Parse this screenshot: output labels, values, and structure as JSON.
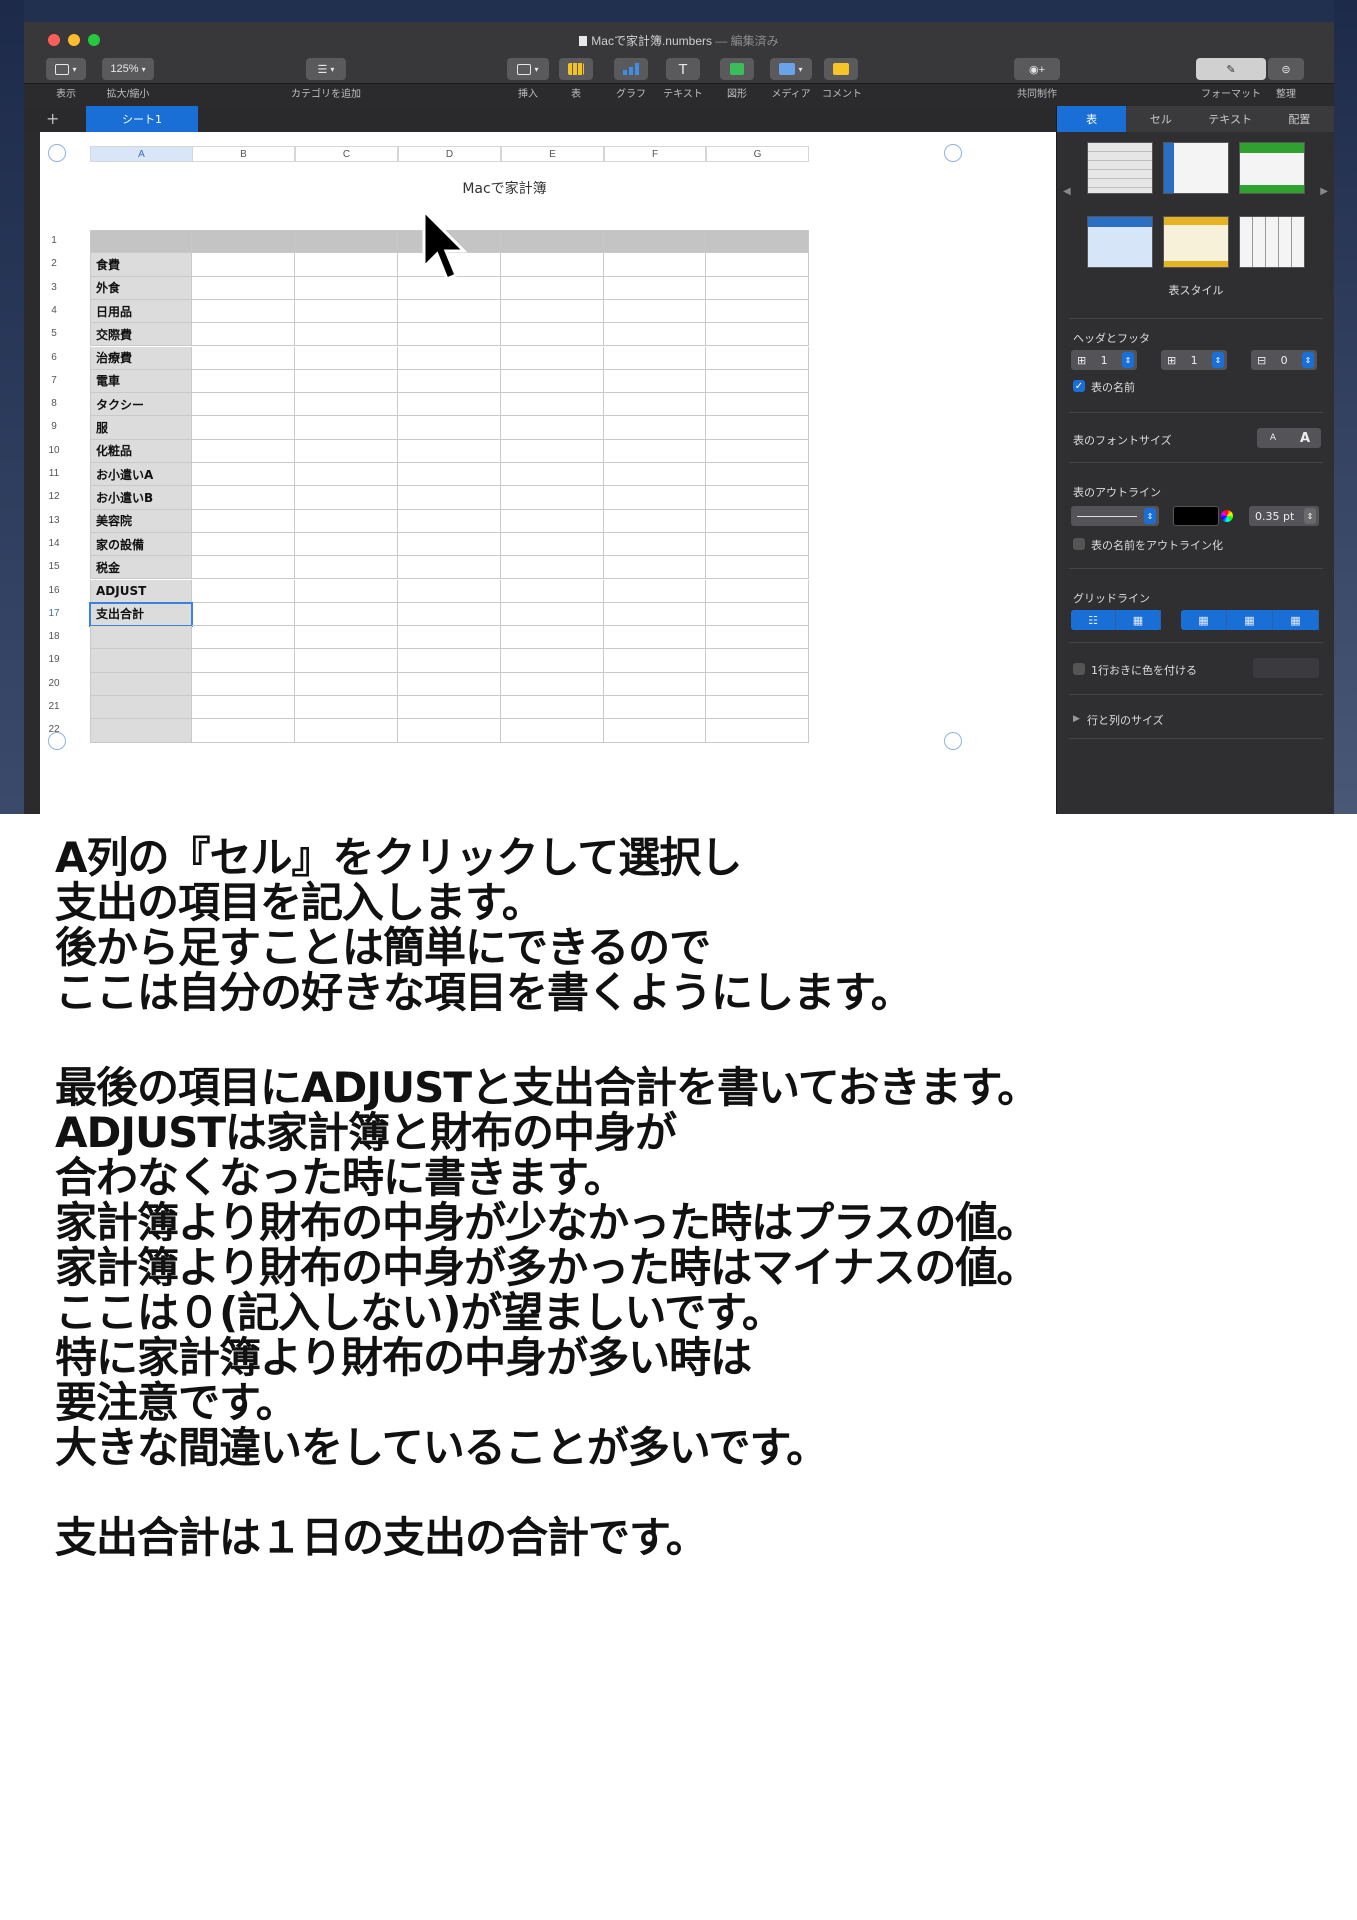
{
  "window": {
    "title": "Macで家計簿.numbers",
    "title_suffix": "— 編集済み"
  },
  "toolbar": {
    "view_label": "表示",
    "zoom_value": "125%",
    "zoom_label": "拡大/縮小",
    "category_label": "カテゴリを追加",
    "insert_label": "挿入",
    "table_label": "表",
    "chart_label": "グラフ",
    "text_label": "テキスト",
    "text_glyph": "T",
    "shape_label": "図形",
    "media_label": "メディア",
    "comment_label": "コメント",
    "collab_label": "共同制作",
    "format_label": "フォーマット",
    "organize_label": "整理"
  },
  "sheets": {
    "add_glyph": "+",
    "active_tab": "シート1"
  },
  "table": {
    "name": "Macで家計簿",
    "columns": [
      "A",
      "B",
      "C",
      "D",
      "E",
      "F",
      "G"
    ],
    "row_numbers": [
      "1",
      "2",
      "3",
      "4",
      "5",
      "6",
      "7",
      "8",
      "9",
      "10",
      "11",
      "12",
      "13",
      "14",
      "15",
      "16",
      "17",
      "18",
      "19",
      "20",
      "21",
      "22"
    ],
    "column_a": [
      "",
      "食費",
      "外食",
      "日用品",
      "交際費",
      "治療費",
      "電車",
      "タクシー",
      "服",
      "化粧品",
      "お小遣いA",
      "お小遣いB",
      "美容院",
      "家の設備",
      "税金",
      "ADJUST",
      "支出合計",
      "",
      "",
      "",
      "",
      ""
    ],
    "selected_row": 17
  },
  "inspector": {
    "tabs": [
      "表",
      "セル",
      "テキスト",
      "配置"
    ],
    "table_style_label": "表スタイル",
    "header_footer_label": "ヘッダとフッタ",
    "header_rows": "1",
    "header_cols": "1",
    "footer_rows": "0",
    "table_name_checkbox": "表の名前",
    "font_size_label": "表のフォントサイズ",
    "font_small": "A",
    "font_large": "A",
    "outline_label": "表のアウトライン",
    "outline_width": "0.35 pt",
    "outline_name_checkbox": "表の名前をアウトライン化",
    "gridlines_label": "グリッドライン",
    "alternate_rows_label": "1行おきに色を付ける",
    "row_col_size_label": "行と列のサイズ"
  },
  "note": {
    "p1": [
      "A列の『セル』をクリックして選択し",
      "支出の項目を記入します。",
      "後から足すことは簡単にできるので",
      "ここは自分の好きな項目を書くようにします。"
    ],
    "p2": [
      "最後の項目にADJUSTと支出合計を書いておきます。",
      "ADJUSTは家計簿と財布の中身が",
      "合わなくなった時に書きます。",
      "家計簿より財布の中身が少なかった時はプラスの値。",
      "家計簿より財布の中身が多かった時はマイナスの値。",
      "ここは０(記入しない)が望ましいです。",
      "特に家計簿より財布の中身が多い時は",
      "要注意です。",
      "大きな間違いをしていることが多いです。"
    ],
    "p3": [
      "支出合計は１日の支出の合計です。"
    ]
  }
}
